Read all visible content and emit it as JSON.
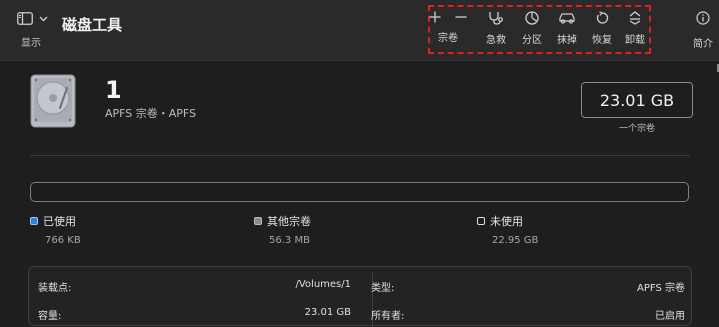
{
  "toolbar": {
    "sidebar_label": "显示",
    "app_title": "磁盘工具",
    "tools": [
      {
        "label": "宗卷",
        "icon": "plus-minus-icon"
      },
      {
        "label": "急救",
        "icon": "stethoscope-icon"
      },
      {
        "label": "分区",
        "icon": "pie-chart-icon"
      },
      {
        "label": "抹掉",
        "icon": "car-eraser-icon"
      },
      {
        "label": "恢复",
        "icon": "restore-icon"
      },
      {
        "label": "卸载",
        "icon": "unmount-icon"
      }
    ],
    "info_label": "简介"
  },
  "disk": {
    "name": "1",
    "subtitle": "APFS 宗卷・APFS",
    "size": "23.01 GB",
    "size_caption": "一个宗卷"
  },
  "usage": {
    "legend": [
      {
        "label": "已使用",
        "value": "766 KB",
        "color": "#2f7fd6"
      },
      {
        "label": "其他宗卷",
        "value": "56.3 MB",
        "color": "#8c8c8c"
      },
      {
        "label": "未使用",
        "value": "22.95 GB",
        "color": "#ffffff"
      }
    ]
  },
  "info": {
    "mount_label": "装载点:",
    "mount_value": "/Volumes/1",
    "type_label": "类型:",
    "type_value": "APFS 宗卷",
    "capacity_label": "容量:",
    "capacity_value": "23.01 GB",
    "owner_label": "所有者:",
    "owner_value": "已启用"
  }
}
